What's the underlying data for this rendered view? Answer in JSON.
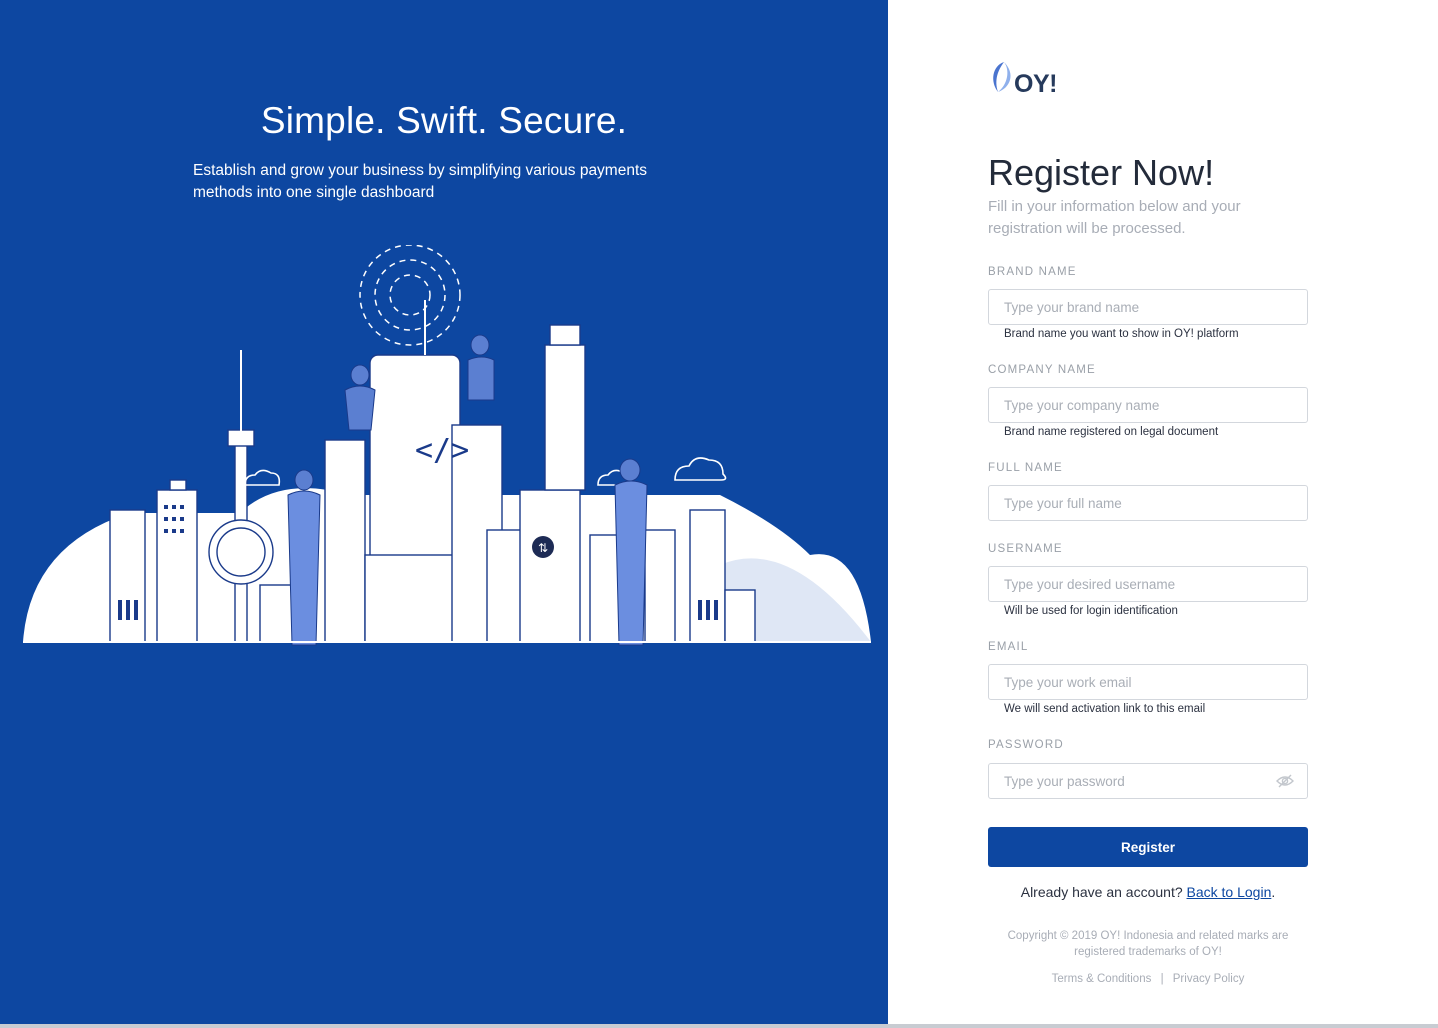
{
  "hero": {
    "title": "Simple. Swift. Secure.",
    "subtitle": "Establish and grow your business by simplifying various payments methods into one single dashboard"
  },
  "brand": {
    "logo_text": "OY!",
    "primary_color": "#0d47a1"
  },
  "form": {
    "title": "Register Now!",
    "subtitle": "Fill in your information below and your registration will be processed.",
    "fields": [
      {
        "label": "BRAND NAME",
        "placeholder": "Type your brand name",
        "value": "",
        "help": "Brand name you want to show in OY! platform"
      },
      {
        "label": "COMPANY NAME",
        "placeholder": "Type your company name",
        "value": "",
        "help": "Brand name registered on legal document"
      },
      {
        "label": "FULL NAME",
        "placeholder": "Type your full name",
        "value": "",
        "help": ""
      },
      {
        "label": "USERNAME",
        "placeholder": "Type your desired username",
        "value": "",
        "help": "Will be used for login identification"
      },
      {
        "label": "EMAIL",
        "placeholder": "Type your work email",
        "value": "",
        "help": "We will send activation link to this email"
      },
      {
        "label": "PASSWORD",
        "placeholder": "Type your password",
        "value": "",
        "help": ""
      }
    ],
    "password_toggle_icon": "eye-off-icon",
    "register_label": "Register",
    "login_prompt": "Already have an account?",
    "login_link": "Back to Login",
    "login_suffix": "."
  },
  "footer": {
    "copyright": "Copyright © 2019 OY! Indonesia and related marks are registered trademarks of OY!",
    "terms": "Terms & Conditions",
    "separator": "|",
    "privacy": "Privacy Policy"
  }
}
